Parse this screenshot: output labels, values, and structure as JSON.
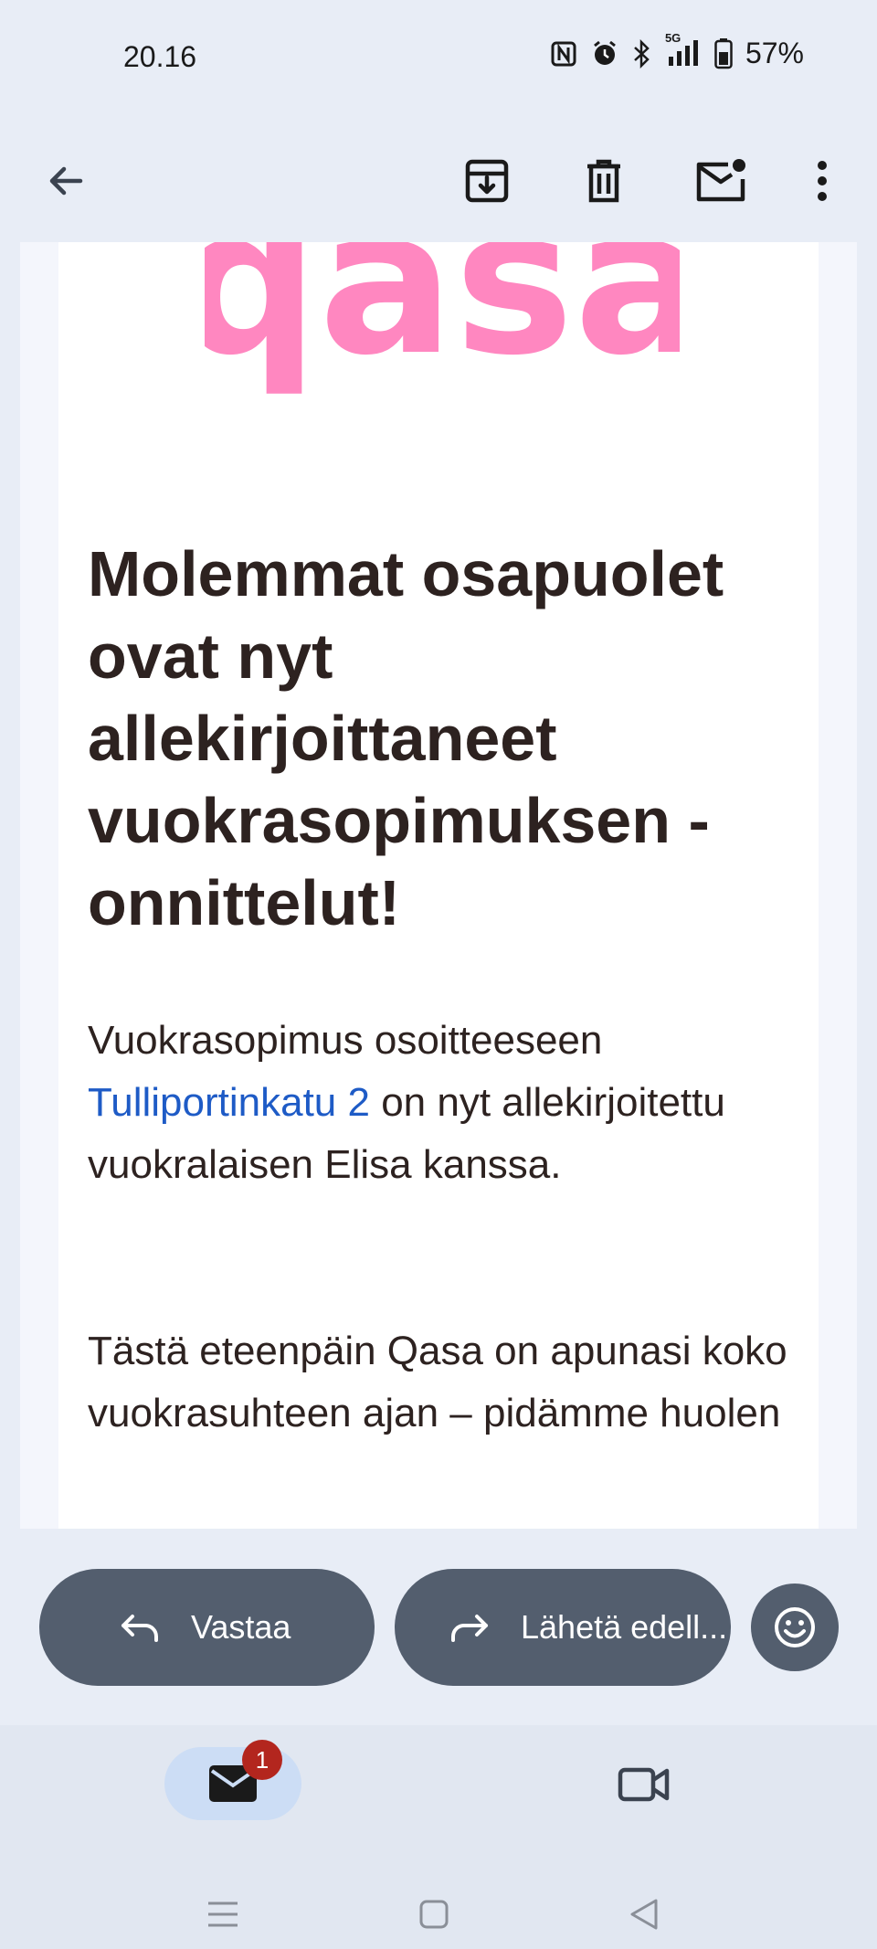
{
  "status_bar": {
    "time": "20.16",
    "network": "5G",
    "battery": "57%",
    "icons": [
      "nfc-icon",
      "alarm-icon",
      "bluetooth-icon",
      "signal-icon",
      "battery-icon"
    ]
  },
  "toolbar": {
    "icons": [
      "back-arrow-icon",
      "archive-icon",
      "trash-icon",
      "mark-unread-icon",
      "more-vertical-icon"
    ]
  },
  "email": {
    "logo_text": "qasa",
    "headline": "Molemmat osapuolet ovat nyt allekirjoittaneet vuokrasopimuksen - onnittelut!",
    "para1_before": "Vuokrasopimus osoitteeseen ",
    "para1_link": "Tulliportinkatu 2",
    "para1_after": " on nyt allekirjoitettu vuokralaisen Elisa kanssa.",
    "para2": "Tästä eteenpäin Qasa on apunasi koko vuokrasuhteen ajan – pidämme huolen"
  },
  "actions": {
    "reply_label": "Vastaa",
    "forward_label": "Lähetä edell..."
  },
  "bottom_nav": {
    "mail_badge": "1"
  },
  "colors": {
    "logo_pink": "#FF87C0",
    "headline_text": "#2D2220",
    "link": "#1E5BC6",
    "pill_bg": "#535E6E",
    "badge_red": "#B3261E"
  }
}
